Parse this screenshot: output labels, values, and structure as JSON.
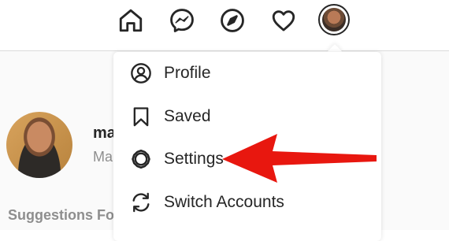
{
  "nav": {
    "icons": [
      "home-icon",
      "messenger-icon",
      "explore-icon",
      "heart-icon"
    ],
    "avatar": "profile-avatar"
  },
  "sidebar": {
    "username": "ma",
    "fullname": "Ma",
    "suggestions_label": "Suggestions Fo"
  },
  "menu": {
    "items": [
      {
        "label": "Profile",
        "icon": "profile-icon"
      },
      {
        "label": "Saved",
        "icon": "bookmark-icon"
      },
      {
        "label": "Settings",
        "icon": "settings-icon"
      },
      {
        "label": "Switch Accounts",
        "icon": "switch-accounts-icon"
      }
    ]
  },
  "colors": {
    "annotation_arrow": "#e8170f",
    "text": "#262626",
    "muted": "#8e8e8e",
    "border": "#dbdbdb"
  }
}
